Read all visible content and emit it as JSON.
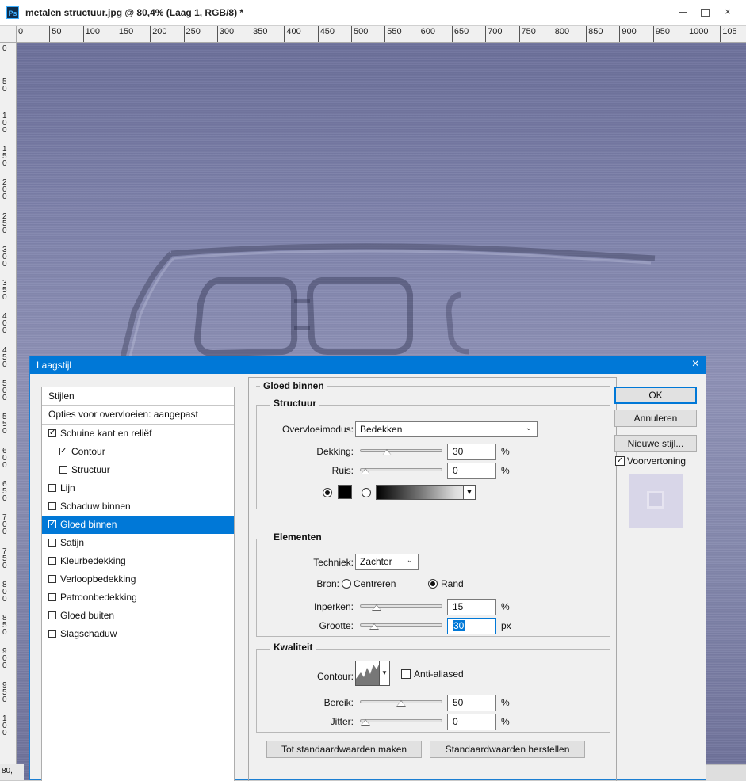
{
  "window": {
    "app_icon": "Ps",
    "title": "metalen structuur.jpg @ 80,4% (Laag 1, RGB/8) *",
    "controls": {
      "minimize": "minimize-icon",
      "maximize": "maximize-icon",
      "close": "×"
    }
  },
  "ruler": {
    "top_labels": [
      "0",
      "50",
      "100",
      "150",
      "200",
      "250",
      "300",
      "350",
      "400",
      "450",
      "500",
      "550",
      "600",
      "650",
      "700",
      "750",
      "800",
      "850",
      "900",
      "950",
      "1000",
      "105"
    ],
    "left_labels": [
      "0",
      "50",
      "100",
      "150",
      "200",
      "250",
      "300",
      "350",
      "400",
      "450",
      "500",
      "550",
      "600",
      "650",
      "700",
      "750",
      "800",
      "850",
      "900",
      "950",
      "100"
    ]
  },
  "zoom_readout": "80,",
  "dialog": {
    "title": "Laagstijl",
    "close": "×",
    "styles_header": "Stijlen",
    "blend_options": "Opties voor overvloeien: aangepast",
    "style_items": [
      {
        "label": "Schuine kant en reliëf",
        "checked": true,
        "indent": false,
        "selected": false
      },
      {
        "label": "Contour",
        "checked": true,
        "indent": true,
        "selected": false
      },
      {
        "label": "Structuur",
        "checked": false,
        "indent": true,
        "selected": false
      },
      {
        "label": "Lijn",
        "checked": false,
        "indent": false,
        "selected": false
      },
      {
        "label": "Schaduw binnen",
        "checked": false,
        "indent": false,
        "selected": false
      },
      {
        "label": "Gloed binnen",
        "checked": true,
        "indent": false,
        "selected": true
      },
      {
        "label": "Satijn",
        "checked": false,
        "indent": false,
        "selected": false
      },
      {
        "label": "Kleurbedekking",
        "checked": false,
        "indent": false,
        "selected": false
      },
      {
        "label": "Verloopbedekking",
        "checked": false,
        "indent": false,
        "selected": false
      },
      {
        "label": "Patroonbedekking",
        "checked": false,
        "indent": false,
        "selected": false
      },
      {
        "label": "Gloed buiten",
        "checked": false,
        "indent": false,
        "selected": false
      },
      {
        "label": "Slagschaduw",
        "checked": false,
        "indent": false,
        "selected": false
      }
    ],
    "section_title": "Gloed binnen",
    "structuur": {
      "legend": "Structuur",
      "blend_mode_label": "Overvloeimodus:",
      "blend_mode_value": "Bedekken",
      "opacity_label": "Dekking:",
      "opacity_value": "30",
      "opacity_unit": "%",
      "opacity_fraction": 0.3,
      "noise_label": "Ruis:",
      "noise_value": "0",
      "noise_unit": "%",
      "noise_fraction": 0.0,
      "color_choice": "solid",
      "solid_color": "#000000"
    },
    "elementen": {
      "legend": "Elementen",
      "technique_label": "Techniek:",
      "technique_value": "Zachter",
      "source_label": "Bron:",
      "source_center": "Centreren",
      "source_edge": "Rand",
      "source_selected": "Rand",
      "choke_label": "Inperken:",
      "choke_value": "15",
      "choke_unit": "%",
      "choke_fraction": 0.15,
      "size_label": "Grootte:",
      "size_value": "30",
      "size_unit": "px",
      "size_fraction": 0.12
    },
    "kwaliteit": {
      "legend": "Kwaliteit",
      "contour_label": "Contour:",
      "anti_aliased_label": "Anti-aliased",
      "anti_aliased_checked": false,
      "range_label": "Bereik:",
      "range_value": "50",
      "range_unit": "%",
      "range_fraction": 0.5,
      "jitter_label": "Jitter:",
      "jitter_value": "0",
      "jitter_unit": "%",
      "jitter_fraction": 0.0
    },
    "make_default": "Tot standaardwaarden maken",
    "reset_default": "Standaardwaarden herstellen",
    "ok": "OK",
    "cancel": "Annuleren",
    "new_style": "Nieuwe stijl...",
    "preview_label": "Voorvertoning",
    "preview_checked": true
  },
  "colors": {
    "accent": "#0078d7",
    "canvas": "#8488ad"
  }
}
